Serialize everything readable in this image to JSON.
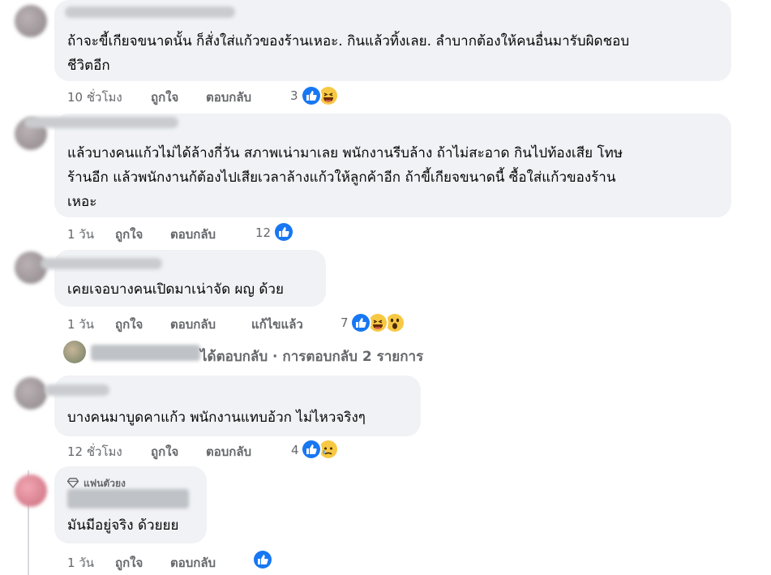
{
  "comments": [
    {
      "lines": [
        "ถ้าจะขี้เกียจขนาดนั้น ก็สั่งใส่แก้วของร้านเหอะ. กินแล้วทิ้งเลย. ลำบากต้องให้คนอื่นมารับผิดชอบ",
        "ชีวิตอีก"
      ],
      "time": "10 ชั่วโมง",
      "like": "ถูกใจ",
      "reply": "ตอบกลับ",
      "reaction_count": "3",
      "reactions": [
        "like-icon",
        "haha-icon"
      ]
    },
    {
      "lines": [
        "แล้วบางคนแก้วไม่ได้ล้างกี่วัน สภาพเน่ามาเลย พนักงานรีบล้าง ถ้าไม่สะอาด กินไปท้องเสีย โทษ",
        "ร้านอีก แล้วพนักงานก้ต้องไปเสียเวลาล้างแก้วให้ลูกค้าอีก ถ้าขี้เกียจขนาดนี้ ซื้อใส่แก้วของร้าน",
        "เหอะ"
      ],
      "time": "1 วัน",
      "like": "ถูกใจ",
      "reply": "ตอบกลับ",
      "reaction_count": "12",
      "reactions": [
        "like-icon"
      ]
    },
    {
      "lines": [
        "เคยเจอบางคนเปิดมาเน่าจัด ผญ ด้วย"
      ],
      "time": "1 วัน",
      "like": "ถูกใจ",
      "reply": "ตอบกลับ",
      "edited": "แก้ไขแล้ว",
      "reaction_count": "7",
      "reactions": [
        "like-icon",
        "haha-icon",
        "wow-icon"
      ]
    },
    {
      "lines": [
        "บางคนมาบูดคาแก้ว พนักงานแทบอ้วก ไม่ไหวจริงๆ"
      ],
      "time": "12 ชั่วโมง",
      "like": "ถูกใจ",
      "reply": "ตอบกลับ",
      "reaction_count": "4",
      "reactions": [
        "like-icon",
        "sad-icon"
      ]
    },
    {
      "badge": "แฟนตัวยง",
      "lines": [
        "มันมีอยู่จริง ด้วยยย"
      ],
      "time": "1 วัน",
      "like": "ถูกใจ",
      "reply": "ตอบกลับ",
      "reactions": [
        "like-icon"
      ]
    }
  ],
  "replies_summary": "ได้ตอบกลับ · การตอบกลับ 2 รายการ",
  "colors": {
    "bubble": "#f0f2f5",
    "meta_text": "#65676b",
    "like_blue": "#1877f2",
    "emoji_yellow": "#f7c843"
  }
}
